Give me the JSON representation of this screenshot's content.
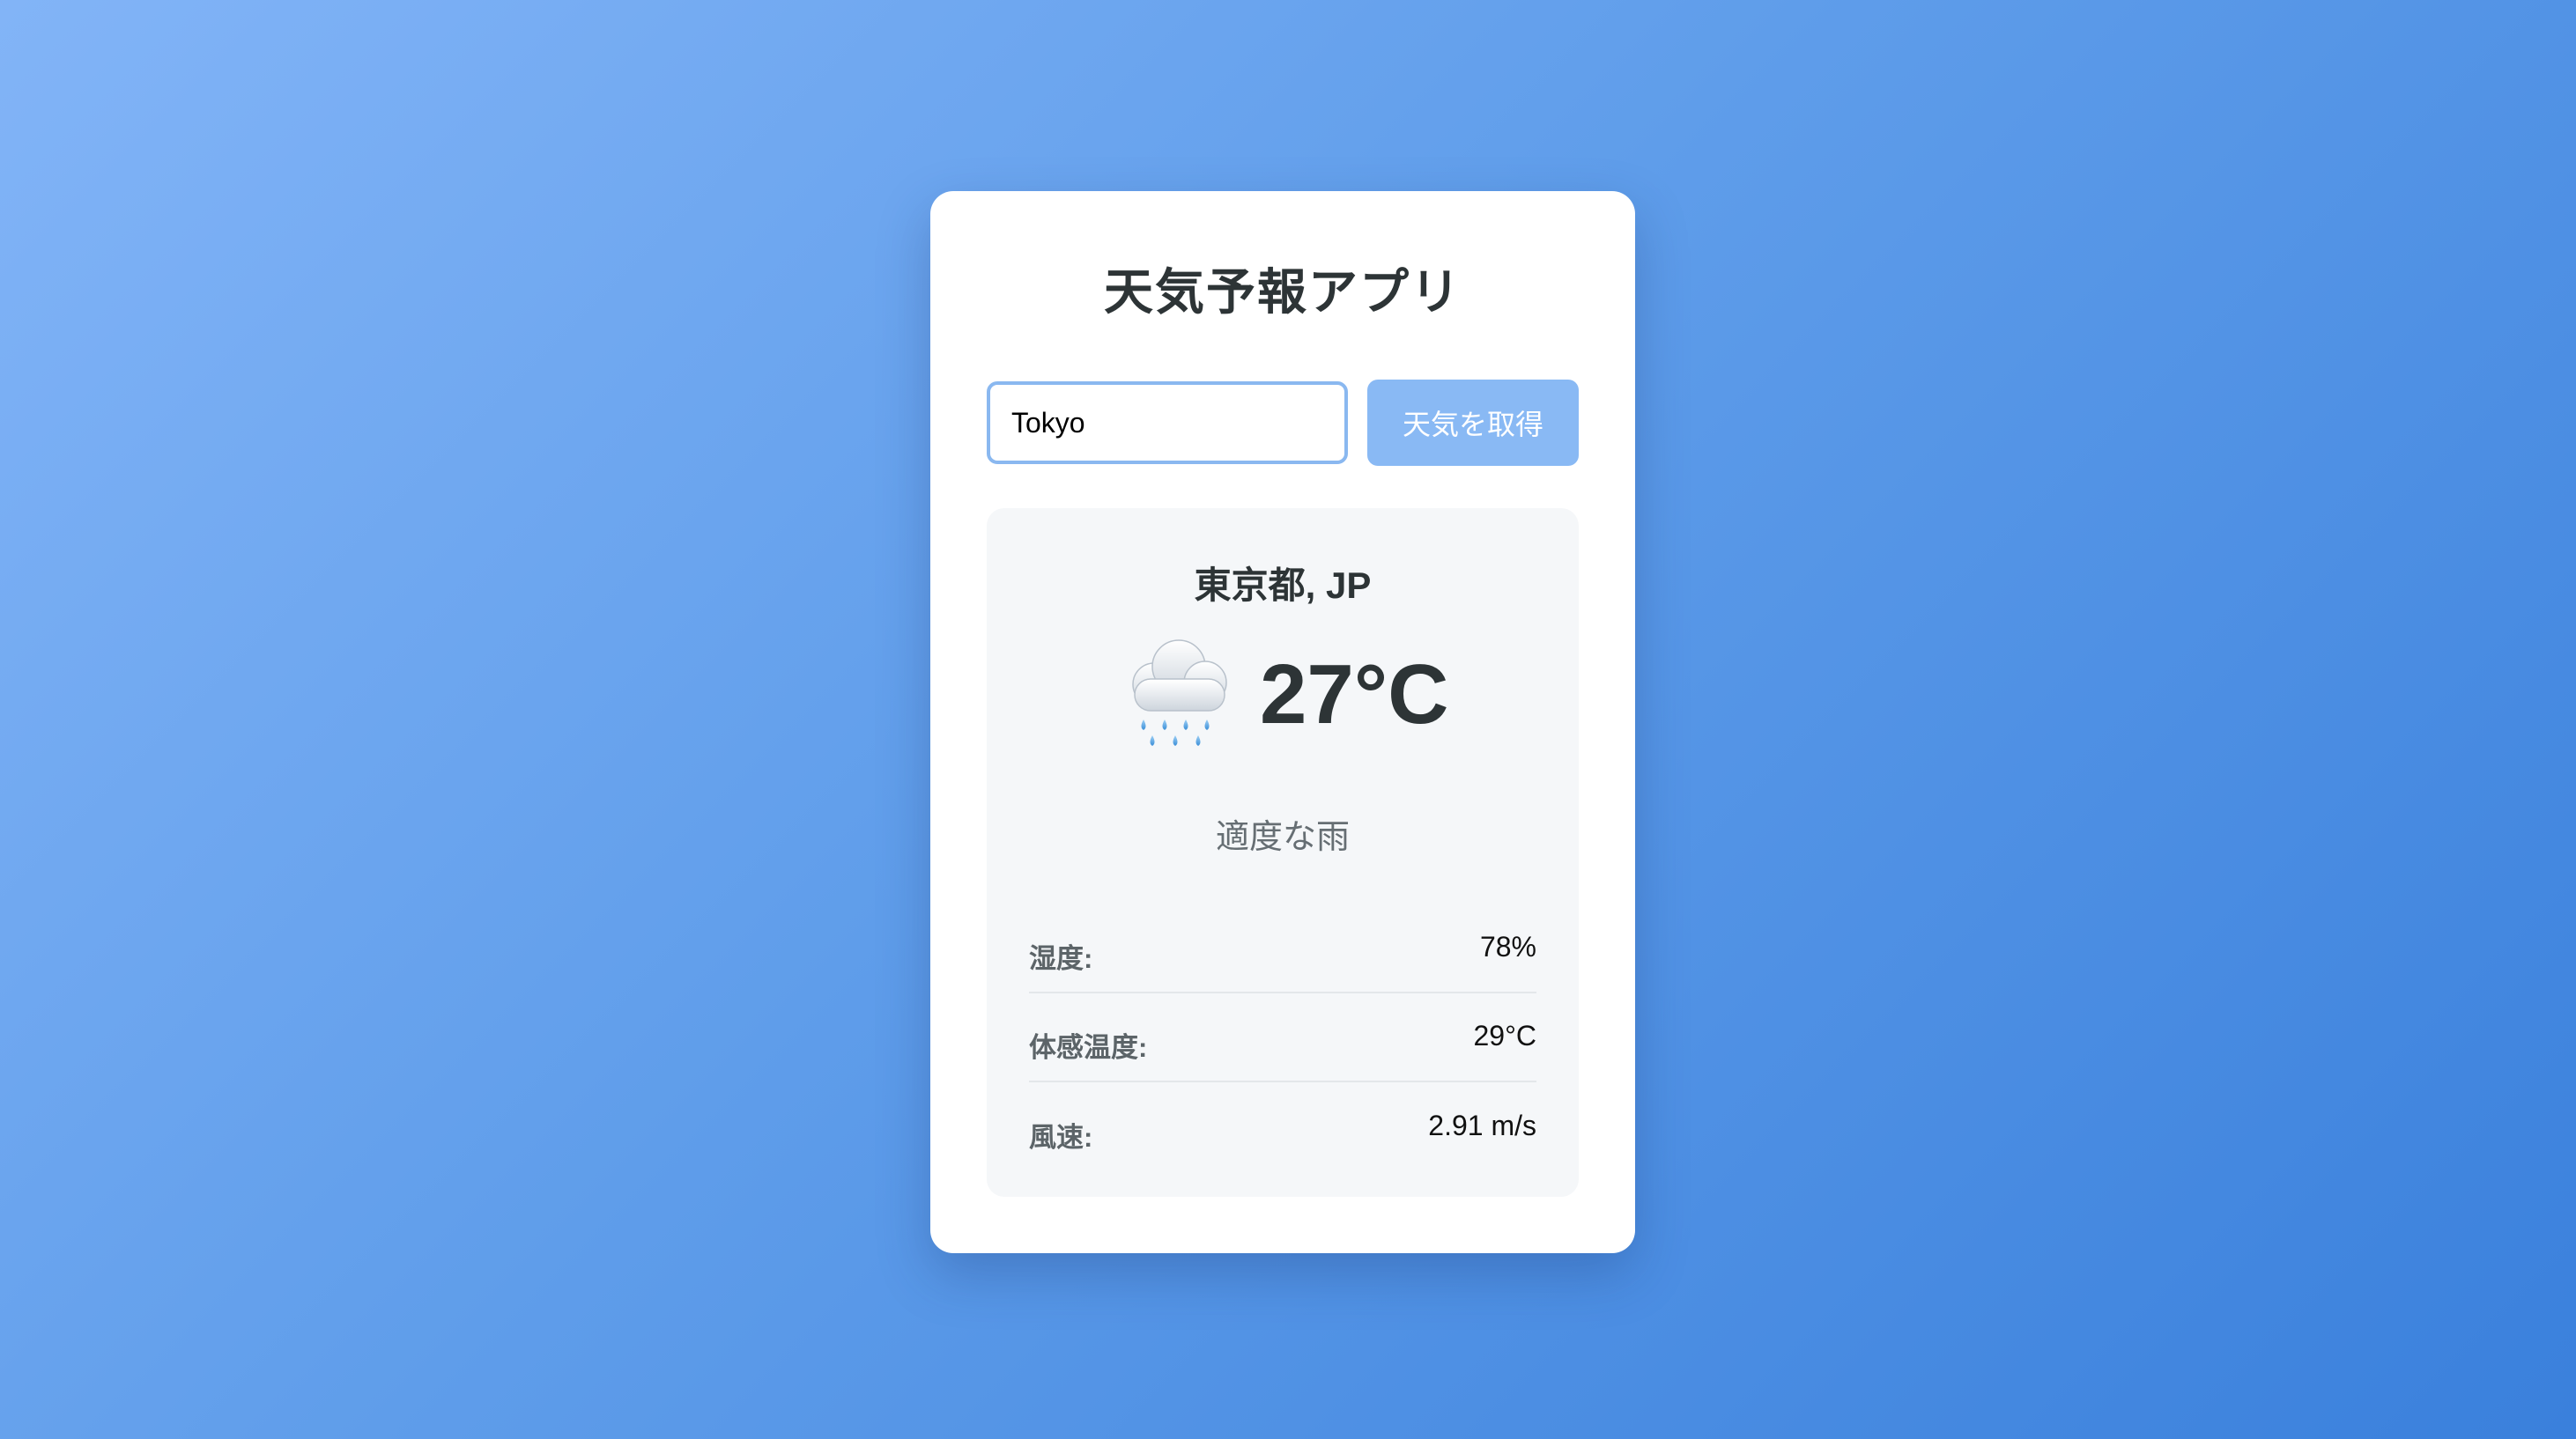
{
  "app": {
    "title": "天気予報アプリ"
  },
  "search": {
    "value": "Tokyo",
    "button_label": "天気を取得"
  },
  "weather": {
    "location": "東京都, JP",
    "icon": "rain-cloud-icon",
    "temperature": "27°C",
    "description": "適度な雨",
    "details": [
      {
        "label": "湿度:",
        "value": "78%"
      },
      {
        "label": "体感温度:",
        "value": "29°C"
      },
      {
        "label": "風速:",
        "value": "2.91 m/s"
      }
    ]
  },
  "colors": {
    "background_start": "#82b4f7",
    "background_end": "#3a80dc",
    "button": "#89b9f4",
    "input_border": "#8ab8f0",
    "panel": "#f5f7f9"
  }
}
